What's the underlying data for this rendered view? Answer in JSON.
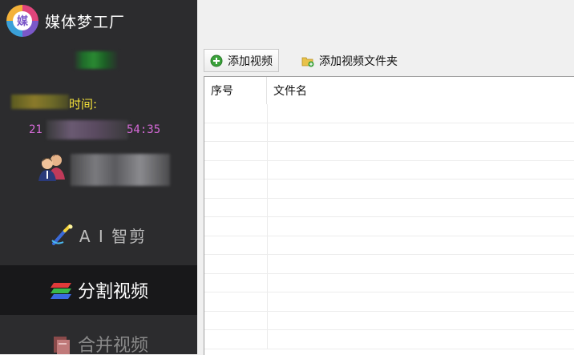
{
  "app": {
    "title": "媒体梦工厂",
    "logo_letter": "媒"
  },
  "sidebar": {
    "expire_label": "时间:",
    "time_left": "21",
    "time_right": "54:35",
    "nav": {
      "ai_label": "A I 智剪",
      "split_label": "分割视频",
      "merge_label": "合并视频"
    }
  },
  "toolbar": {
    "add_video_label": "添加视频",
    "add_folder_label": "添加视频文件夹"
  },
  "list": {
    "columns": [
      "序号",
      "文件名"
    ],
    "rows": []
  },
  "colors": {
    "sidebar_bg": "#2c2c2e",
    "selected_nav_bg": "#18181a",
    "expire_text": "#f5e33a",
    "time_text": "#d66ad8",
    "add_icon": "#3aa13a",
    "folder_icon": "#e8c24a"
  },
  "icons": {
    "logo": "media-factory-logo",
    "user": "users-icon",
    "ai": "ai-wand-icon",
    "split": "split-stripes-icon",
    "merge": "merge-pages-icon",
    "add": "plus-circle-icon",
    "folder": "folder-add-icon"
  }
}
